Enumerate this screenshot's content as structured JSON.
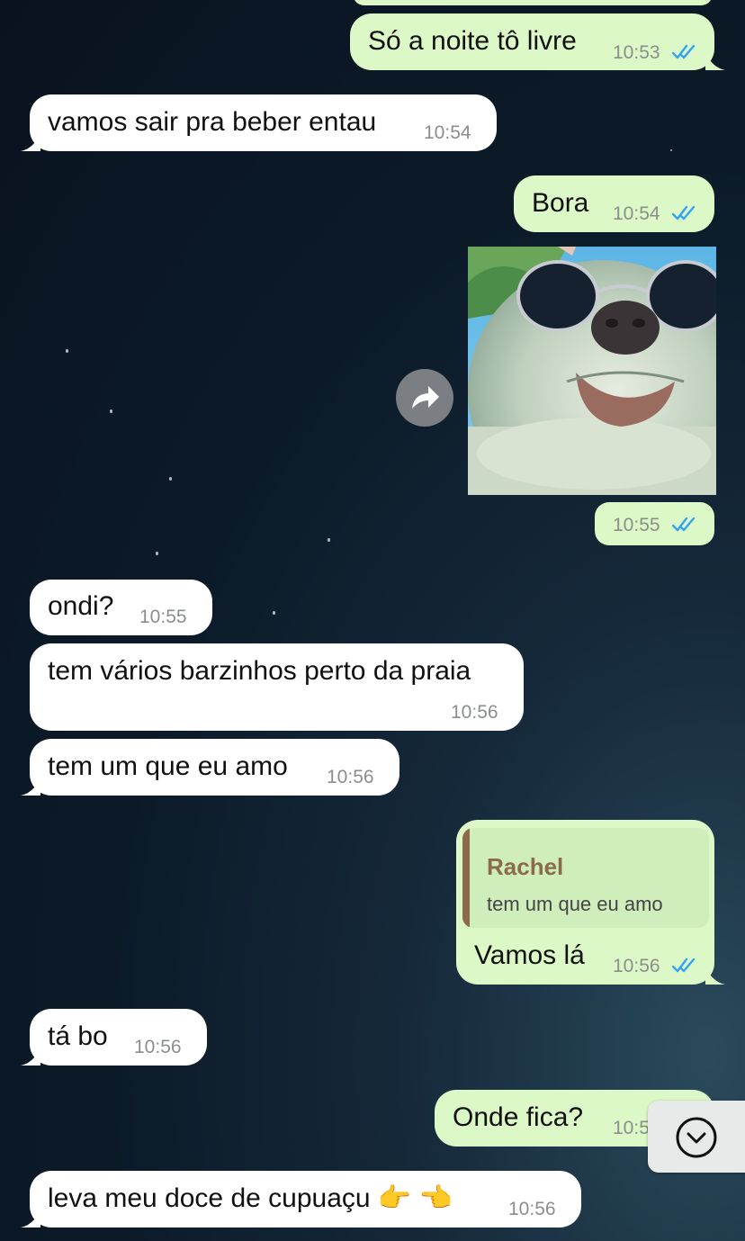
{
  "messages": [
    {
      "text": "Só a noite tô livre",
      "time": "10:53"
    },
    {
      "text": "vamos sair pra beber entau",
      "time": "10:54"
    },
    {
      "text": "Bora",
      "time": "10:54"
    },
    {
      "time": "10:55"
    },
    {
      "text": "ondi?",
      "time": "10:55"
    },
    {
      "text": "tem vários barzinhos perto da praia",
      "time": "10:56"
    },
    {
      "text": "tem um que eu amo",
      "time": "10:56"
    },
    {
      "reply_author": "Rachel",
      "reply_text": "tem um que eu amo",
      "text": "Vamos lá",
      "time": "10:56"
    },
    {
      "text": "tá bo",
      "time": "10:56"
    },
    {
      "text": "Onde fica?",
      "time": "10:5"
    },
    {
      "text": "leva meu doce de cupuaçu 👉 👈",
      "time": "10:56"
    }
  ],
  "colors": {
    "incoming": "#ffffff",
    "outgoing": "#dcf8c6",
    "read_ticks": "#34a3f0",
    "reply_bar": "#8b6a4e",
    "reply_author": "#8b6a4e"
  },
  "icons": {
    "forward": "forward-icon",
    "scroll_down": "chevron-down-icon",
    "read": "double-check-icon"
  }
}
